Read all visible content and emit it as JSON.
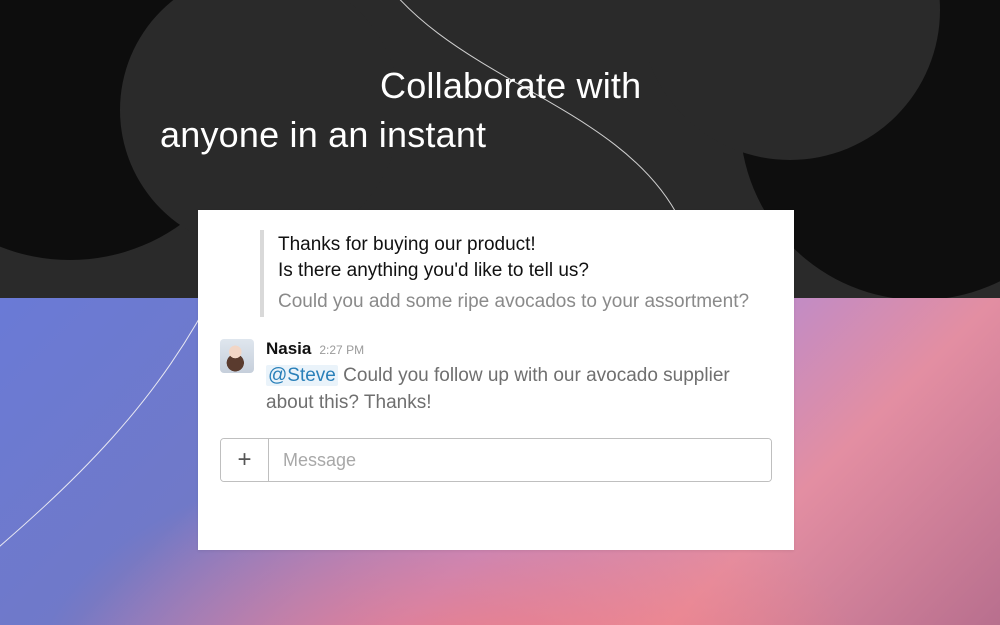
{
  "headline": {
    "line1": "Collaborate with",
    "line2": "anyone in an instant"
  },
  "quote": {
    "prompt_line1": "Thanks for buying our product!",
    "prompt_line2": "Is there anything you'd like to tell us?",
    "response": "Could you add some ripe avocados to your assortment?"
  },
  "message": {
    "author": "Nasia",
    "timestamp": "2:27 PM",
    "mention": "@Steve",
    "body_rest": " Could you follow up with our avocado supplier about this? Thanks!"
  },
  "composer": {
    "placeholder": "Message",
    "plus_label": "+"
  }
}
